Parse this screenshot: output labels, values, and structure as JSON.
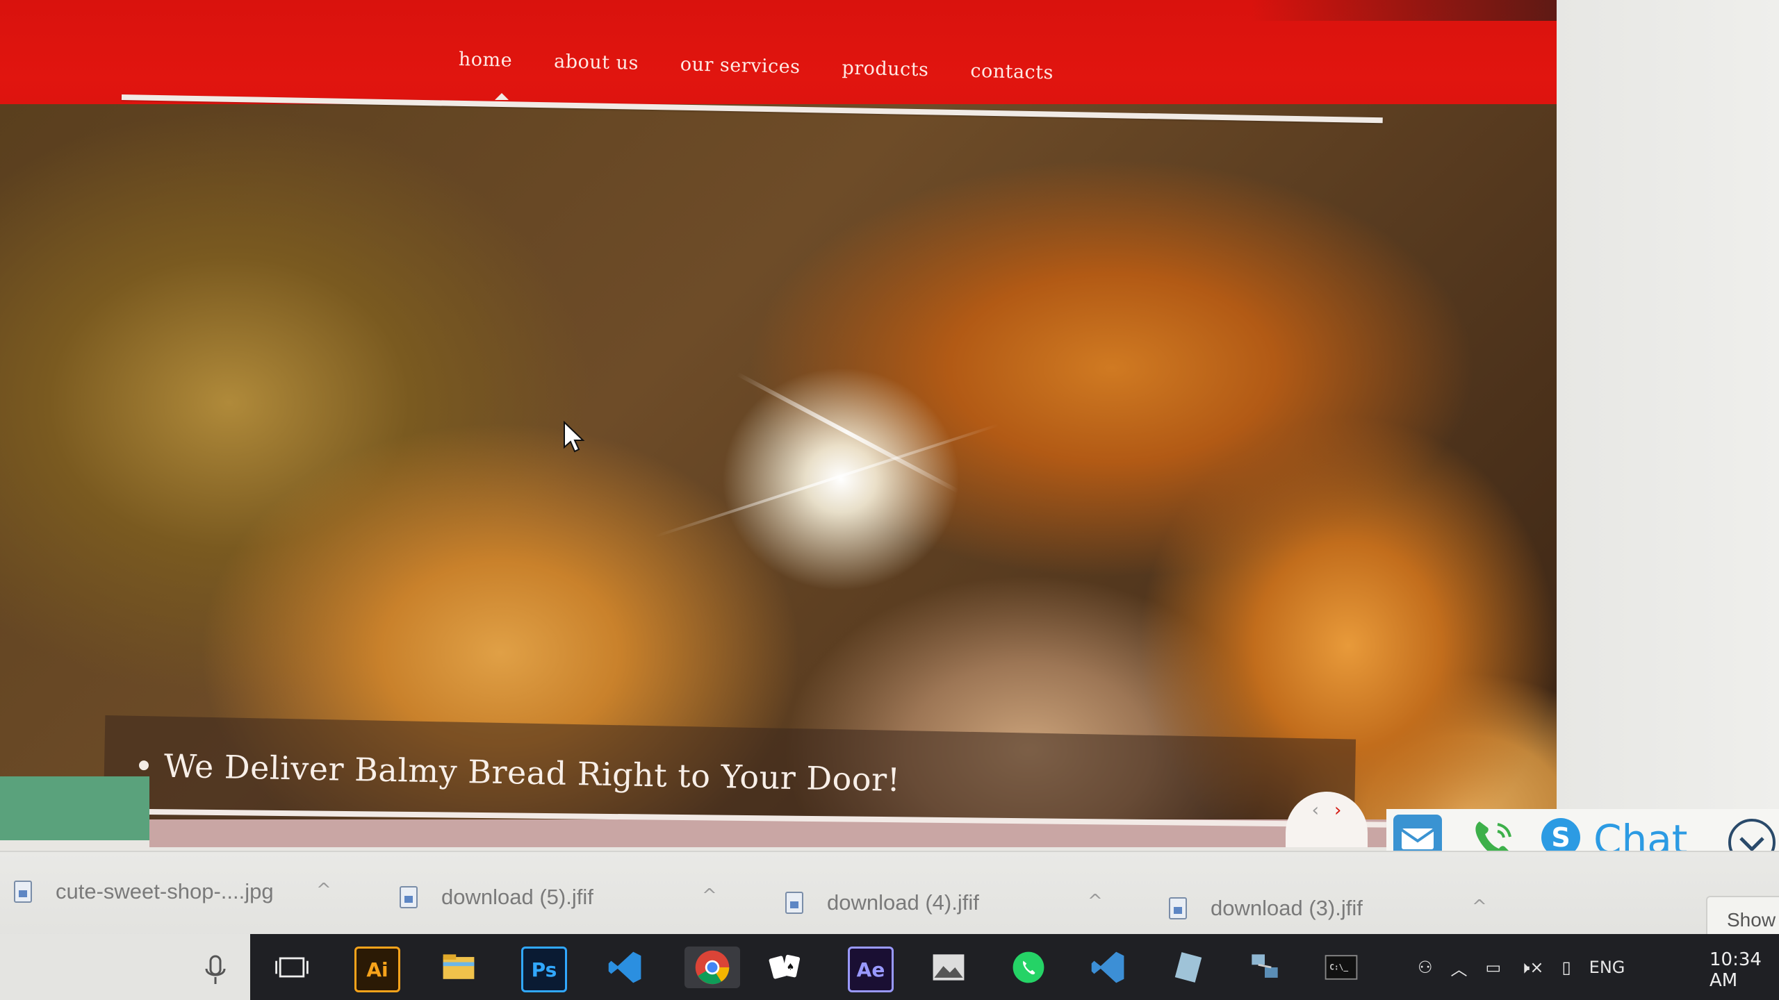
{
  "nav": {
    "items": [
      "home",
      "about us",
      "our services",
      "products",
      "contacts"
    ],
    "active": "home"
  },
  "hero": {
    "caption": "We Deliver Balmy Bread Right to Your Door!",
    "pager_prev": "‹",
    "pager_next": "›"
  },
  "contact_widget": {
    "chat_label": "Chat"
  },
  "downloads": {
    "items": [
      {
        "name": "cute-sweet-shop-....jpg"
      },
      {
        "name": "download (5).jfif"
      },
      {
        "name": "download (4).jfif"
      },
      {
        "name": "download (3).jfif"
      }
    ],
    "show_all_label": "Show"
  },
  "taskbar": {
    "apps": [
      "task-view",
      "illustrator",
      "file-explorer",
      "photoshop",
      "vscode",
      "chrome",
      "solitaire",
      "after-effects",
      "photos",
      "whatsapp",
      "vscode-alt",
      "notes",
      "network-tool",
      "command-prompt"
    ],
    "ai_label": "Ai",
    "ps_label": "Ps",
    "ae_label": "Ae",
    "language": "ENG",
    "time": "10:34 AM"
  },
  "colors": {
    "header_red": "#e0140e",
    "chat_blue": "#2c9be3",
    "taskbar": "#1f2024",
    "caption_text": "#f8efe8"
  }
}
